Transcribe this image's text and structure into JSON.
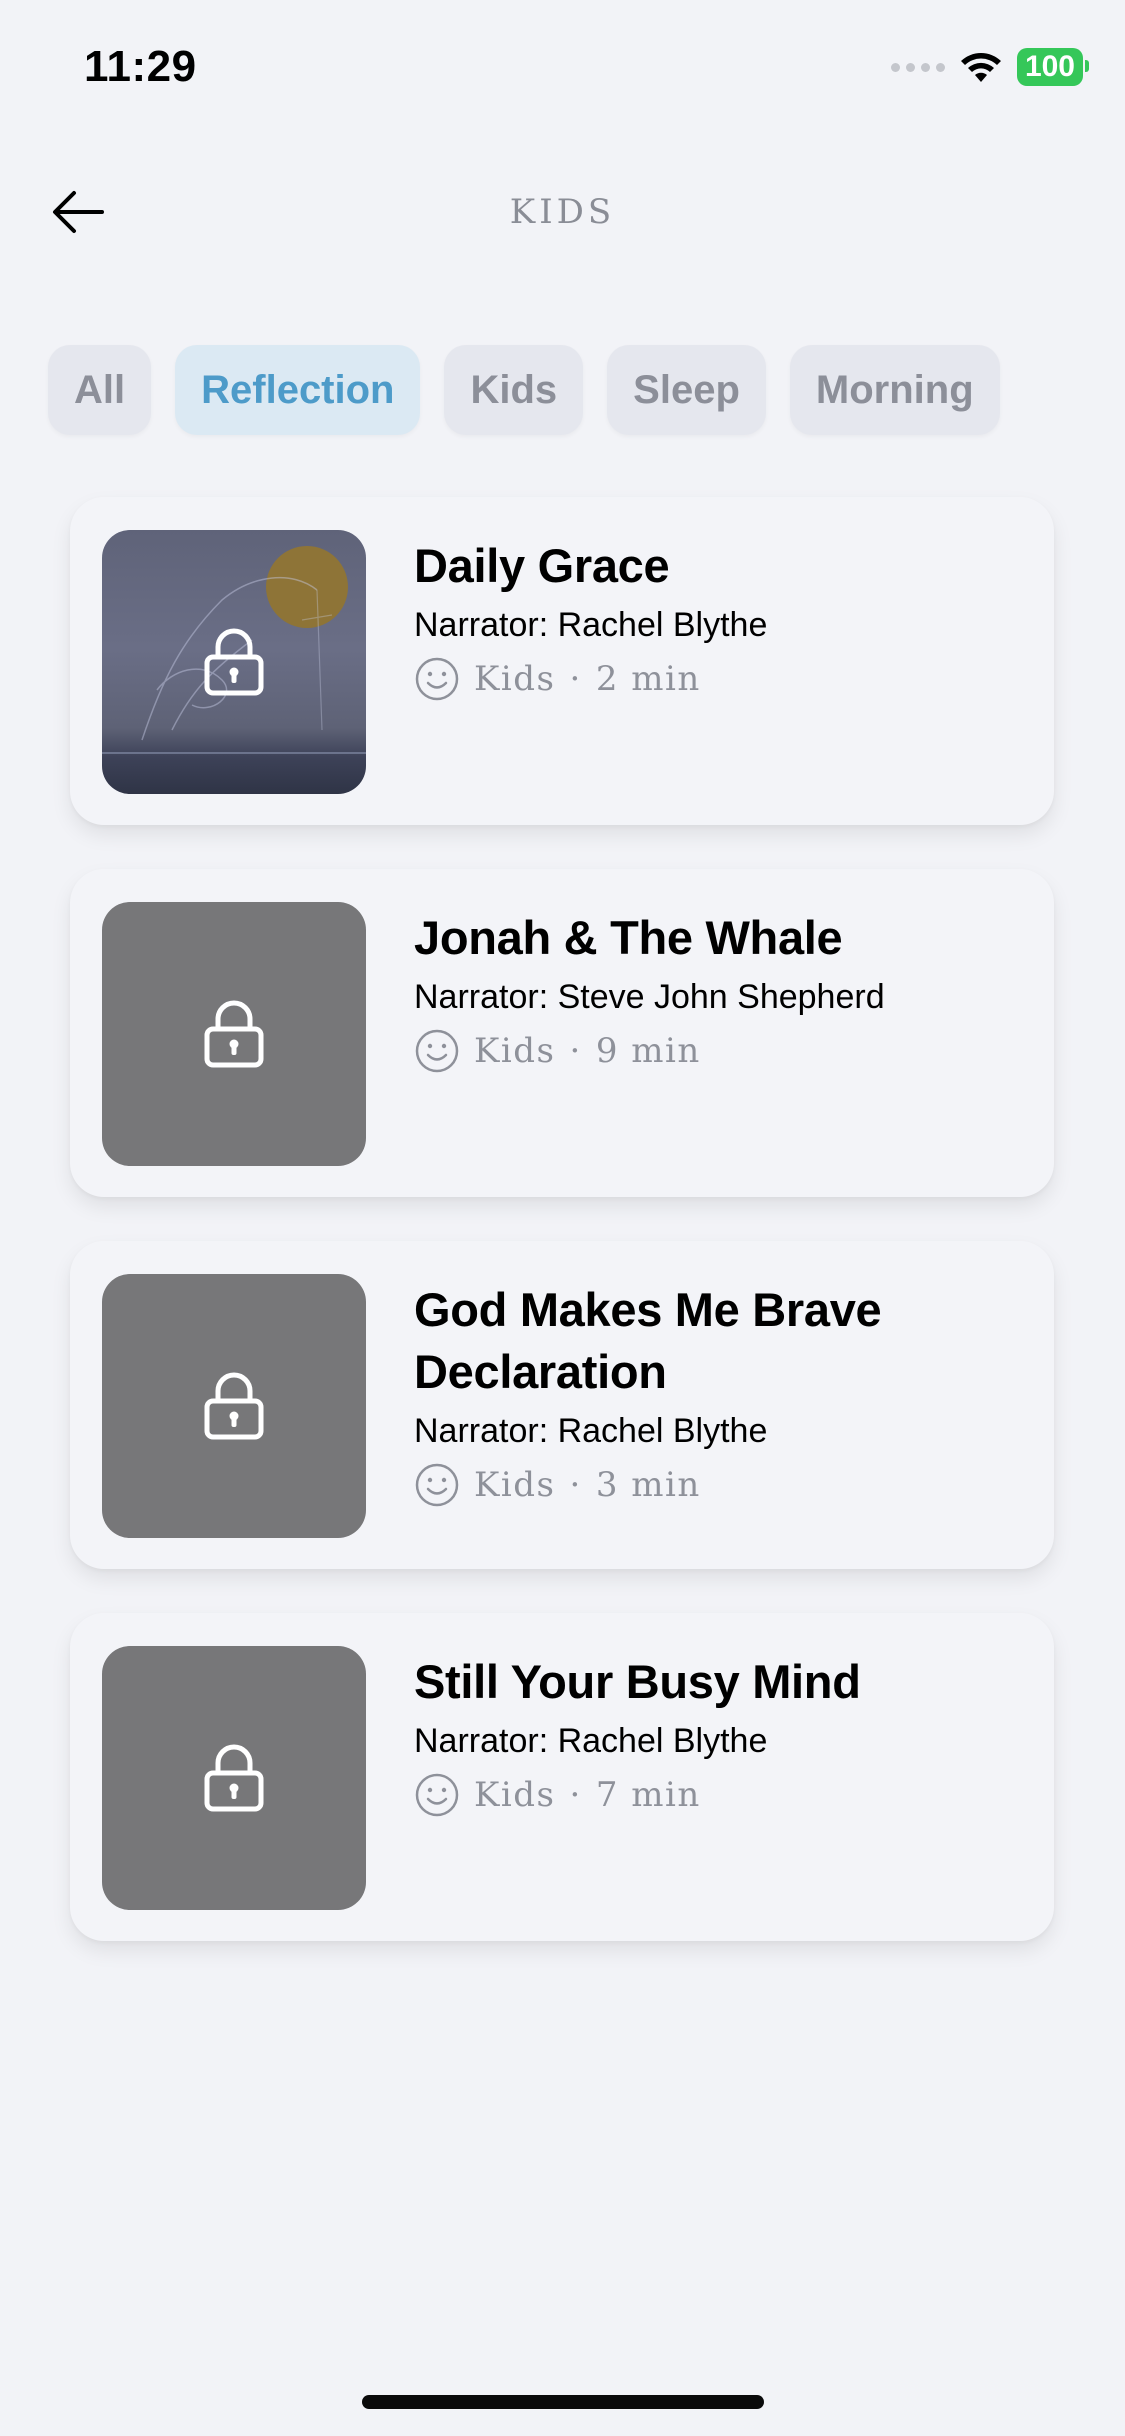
{
  "status_bar": {
    "time": "11:29",
    "battery": "100",
    "colors": {
      "battery": "#35c759"
    }
  },
  "header": {
    "title": "KIDS",
    "back_icon": "arrow-left-icon"
  },
  "filters": [
    {
      "label": "All",
      "active": false
    },
    {
      "label": "Reflection",
      "active": true
    },
    {
      "label": "Kids",
      "active": false
    },
    {
      "label": "Sleep",
      "active": false
    },
    {
      "label": "Morning",
      "active": false
    }
  ],
  "items": [
    {
      "title": "Daily Grace",
      "narrator": "Narrator: Rachel Blythe",
      "category": "Kids",
      "duration": "2 min",
      "locked": true,
      "has_artwork": true
    },
    {
      "title": "Jonah & The Whale",
      "narrator": "Narrator: Steve John Shepherd",
      "category": "Kids",
      "duration": "9 min",
      "locked": true,
      "has_artwork": false
    },
    {
      "title": "God Makes Me Brave Declaration",
      "narrator": "Narrator: Rachel Blythe",
      "category": "Kids",
      "duration": "3 min",
      "locked": true,
      "has_artwork": false
    },
    {
      "title": "Still Your Busy Mind",
      "narrator": "Narrator: Rachel Blythe",
      "category": "Kids",
      "duration": "7 min",
      "locked": true,
      "has_artwork": false
    }
  ],
  "meta_separator": "·",
  "colors": {
    "background": "#f2f3f7",
    "chip_active_bg": "#dbe9f3",
    "chip_active_text": "#4d9bc9",
    "chip_inactive_text": "#8c8f99",
    "placeholder_thumb": "#777779"
  }
}
